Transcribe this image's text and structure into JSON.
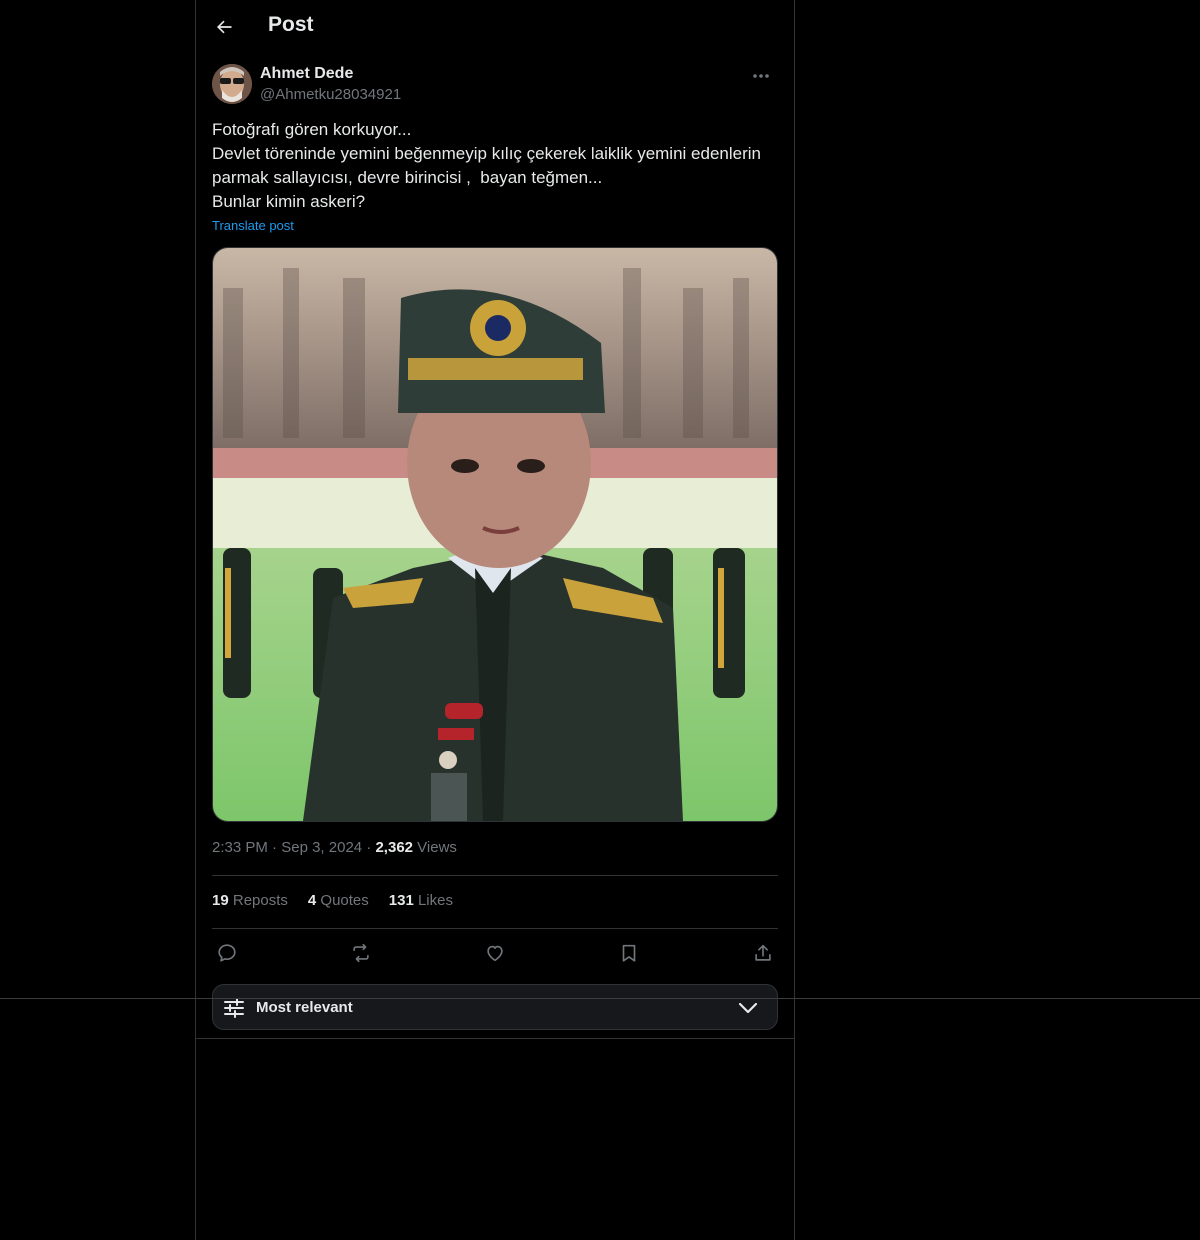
{
  "header": {
    "title": "Post",
    "back_icon": "arrow-left-icon"
  },
  "post": {
    "author": {
      "name": "Ahmet Dede",
      "handle": "@Ahmetku28034921",
      "avatar_icon": "user-avatar"
    },
    "text": "Fotoğrafı gören korkuyor...\nDevlet töreninde yemini beğenmeyip kılıç çekerek laiklik yemini edenlerin parmak sallayıcısı, devre birincisi ,  bayan teğmen...\nBunlar kimin askeri?",
    "translate_label": "Translate post",
    "meta": {
      "time": "2:33 PM",
      "dot1": " · ",
      "date": "Sep 3, 2024",
      "dot2": " · ",
      "views_count": "2,362",
      "views_label": " Views"
    },
    "stats": {
      "reposts_count": "19",
      "reposts_label": " Reposts",
      "quotes_count": "4",
      "quotes_label": " Quotes",
      "likes_count": "131",
      "likes_label": " Likes"
    },
    "actions": [
      "reply-icon",
      "repost-icon",
      "like-icon",
      "bookmark-icon",
      "share-icon"
    ]
  },
  "sort": {
    "label": "Most relevant",
    "icon": "sliders-icon",
    "chevron": "chevron-down-icon"
  },
  "colors": {
    "background": "#000000",
    "text": "#e7e9ea",
    "muted": "#71767b",
    "accent": "#1d9bf0",
    "border": "#2f3336"
  }
}
